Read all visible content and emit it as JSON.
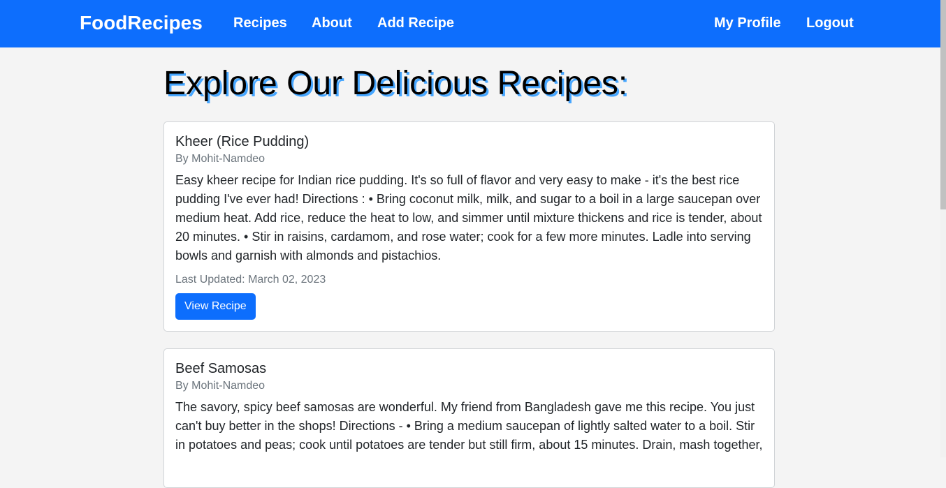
{
  "nav": {
    "brand": "FoodRecipes",
    "links": [
      "Recipes",
      "About",
      "Add Recipe"
    ],
    "right_links": [
      "My Profile",
      "Logout"
    ],
    "accent": "#0d6efd"
  },
  "page": {
    "title": "Explore Our Delicious Recipes:"
  },
  "recipes": [
    {
      "title": "Kheer (Rice Pudding)",
      "author": "By Mohit-Namdeo",
      "description": "Easy kheer recipe for Indian rice pudding. It's so full of flavor and very easy to make - it's the best rice pudding I've ever had! Directions : • Bring coconut milk, milk, and sugar to a boil in a large saucepan over medium heat. Add rice, reduce the heat to low, and simmer until mixture thickens and rice is tender, about 20 minutes. • Stir in raisins, cardamom, and rose water; cook for a few more minutes. Ladle into serving bowls and garnish with almonds and pistachios.",
      "updated": "Last Updated: March 02, 2023",
      "button": "View Recipe"
    },
    {
      "title": "Beef Samosas",
      "author": "By Mohit-Namdeo",
      "description": "The savory, spicy beef samosas are wonderful. My friend from Bangladesh gave me this recipe. You just can't buy better in the shops! Directions - • Bring a medium saucepan of lightly salted water to a boil. Stir in potatoes and peas; cook until potatoes are tender but still firm, about 15 minutes. Drain, mash together,"
    }
  ]
}
